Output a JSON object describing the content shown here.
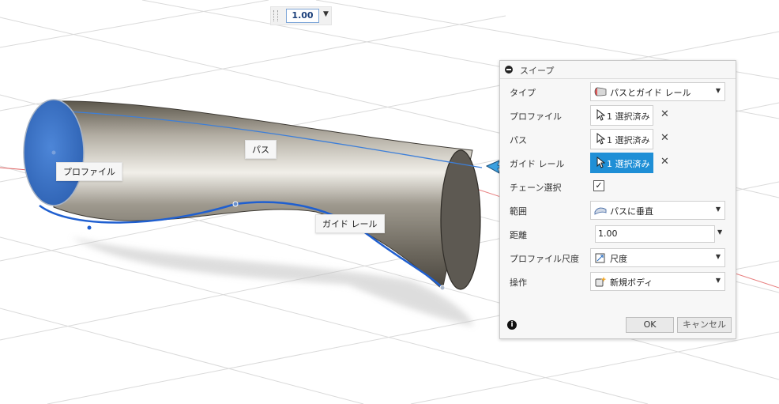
{
  "viewport": {
    "labels": {
      "profile": "プロファイル",
      "path": "パス",
      "guide_rail": "ガイド レール"
    }
  },
  "floating_input": {
    "value": "1.00"
  },
  "panel": {
    "title": "スイープ",
    "rows": {
      "type": {
        "label": "タイプ",
        "value": "パスとガイド レール",
        "icon": "sweep-type-icon"
      },
      "profile": {
        "label": "プロファイル",
        "value": "1 選択済み"
      },
      "path": {
        "label": "パス",
        "value": "1 選択済み"
      },
      "guide_rail": {
        "label": "ガイド レール",
        "value": "1 選択済み"
      },
      "chain": {
        "label": "チェーン選択",
        "checked": true
      },
      "extent": {
        "label": "範囲",
        "value": "パスに垂直",
        "icon": "perpendicular-icon"
      },
      "distance": {
        "label": "距離",
        "value": "1.00"
      },
      "profile_scaling": {
        "label": "プロファイル尺度",
        "value": "尺度",
        "icon": "scale-icon"
      },
      "operation": {
        "label": "操作",
        "value": "新規ボディ",
        "icon": "new-body-icon"
      }
    },
    "buttons": {
      "ok": "OK",
      "cancel": "キャンセル"
    }
  },
  "colors": {
    "accent": "#1f8fd6",
    "profile_face": "#3c74c9",
    "rail": "#1f5fd0"
  }
}
